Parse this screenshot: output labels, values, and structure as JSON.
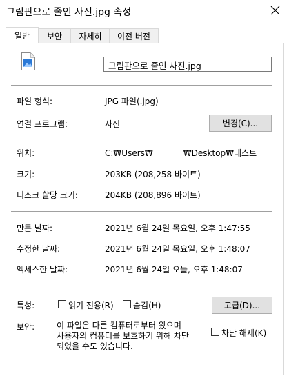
{
  "window": {
    "title": "그림판으로 줄인 사진.jpg 속성"
  },
  "tabs": [
    {
      "label": "일반"
    },
    {
      "label": "보안"
    },
    {
      "label": "자세히"
    },
    {
      "label": "이전 버전"
    }
  ],
  "general": {
    "file_name": "그림판으로 줄인 사진.jpg",
    "file_type_label": "파일 형식:",
    "file_type_value": "JPG 파일(.jpg)",
    "opens_with_label": "연결 프로그램:",
    "opens_with_value": "사진",
    "change_button": "변경(C)...",
    "location_label": "위치:",
    "location_prefix": "C:₩Users₩",
    "location_suffix": "₩Desktop₩테스트",
    "size_label": "크기:",
    "size_value": "203KB (208,258 바이트)",
    "size_on_disk_label": "디스크 할당 크기:",
    "size_on_disk_value": "204KB (208,896 바이트)",
    "created_label": "만든 날짜:",
    "created_value": "2021년 6월 24일 목요일, 오후 1:47:55",
    "modified_label": "수정한 날짜:",
    "modified_value": "2021년 6월 24일 목요일, 오후 1:48:07",
    "accessed_label": "액세스한 날짜:",
    "accessed_value": "2021년 6월 24일 오늘, 오후 1:48:07",
    "attributes_label": "특성:",
    "readonly_label": "읽기 전용(R)",
    "hidden_label": "숨김(H)",
    "advanced_button": "고급(D)...",
    "security_label": "보안:",
    "security_line1": "이 파일은 다른 컴퓨터로부터 왔으며",
    "security_line2": "사용자의 컴퓨터를 보호하기 위해 차단",
    "security_line3": "되었을 수도 있습니다.",
    "unblock_label": "차단 해제(K)"
  }
}
